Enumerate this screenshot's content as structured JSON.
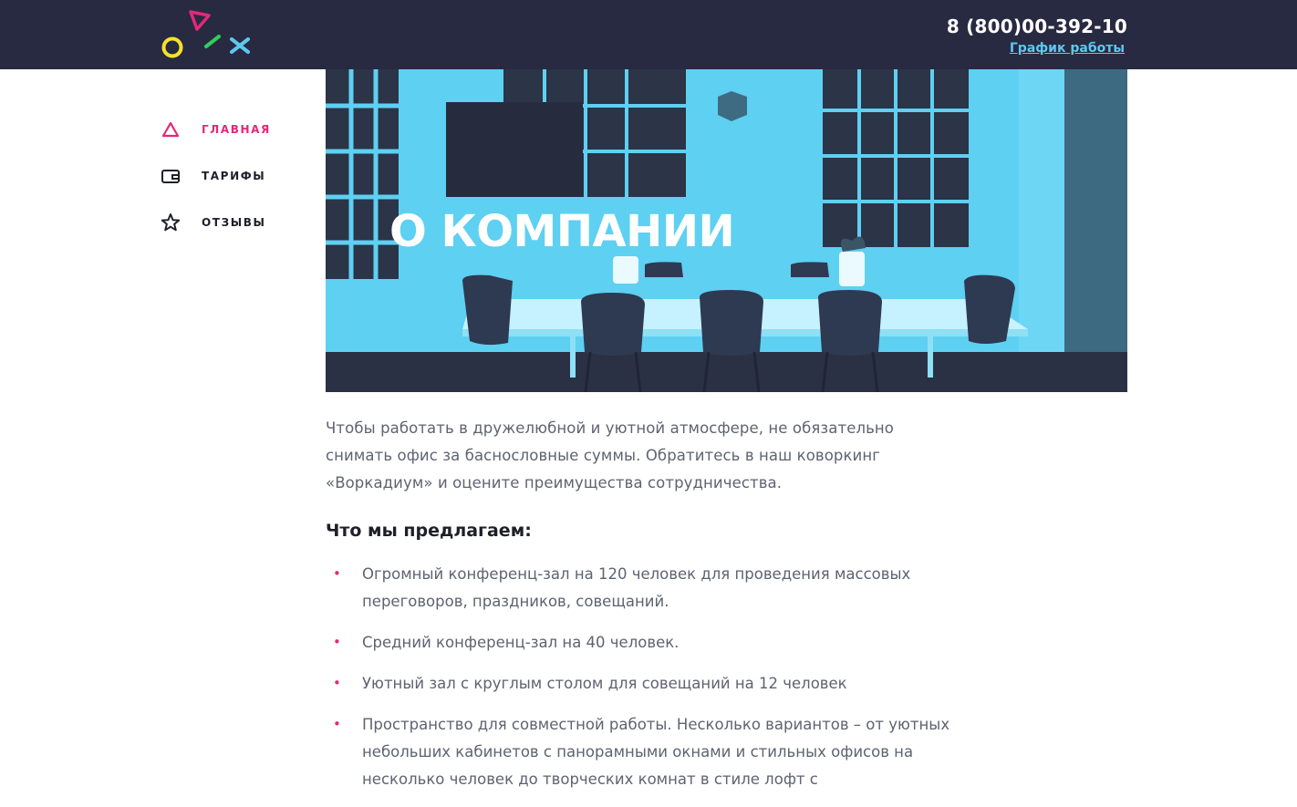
{
  "header": {
    "phone": "8 (800)00-392-10",
    "schedule_link": "График работы",
    "logo_icon": "oix-shapes-logo-icon"
  },
  "nav": {
    "items": [
      {
        "label": "ГЛАВНАЯ",
        "icon": "triangle-icon",
        "active": true
      },
      {
        "label": "ТАРИФЫ",
        "icon": "wallet-icon",
        "active": false
      },
      {
        "label": "ОТЗЫВЫ",
        "icon": "star-icon",
        "active": false
      }
    ]
  },
  "hero": {
    "title": "О КОМПАНИИ"
  },
  "content": {
    "intro": "Чтобы работать в дружелюбной и уютной атмосфере, не обязательно снимать офис за баснословные суммы. Обратитесь в наш коворкинг «Воркадиум» и оцените преимущества сотрудничества.",
    "subheading": "Что мы предлагаем:",
    "bullet_symbol": "•",
    "offers": [
      "Огромный конференц-зал на 120 человек для проведения массовых переговоров, праздников, совещаний.",
      "Средний конференц-зал на 40 человек.",
      "Уютный зал с круглым столом для совещаний на 12 человек",
      "Пространство для совместной работы. Несколько вариантов – от уютных небольших кабинетов с панорамными окнами и стильных офисов на несколько человек до творческих комнат в стиле лофт с"
    ]
  },
  "colors": {
    "header_bg": "#282a41",
    "accent_pink": "#e2287a",
    "link_blue": "#5ec8ee",
    "hero_cyan": "#5ed0f2",
    "logo_yellow": "#f5e22c",
    "logo_green": "#2fcf5a"
  }
}
